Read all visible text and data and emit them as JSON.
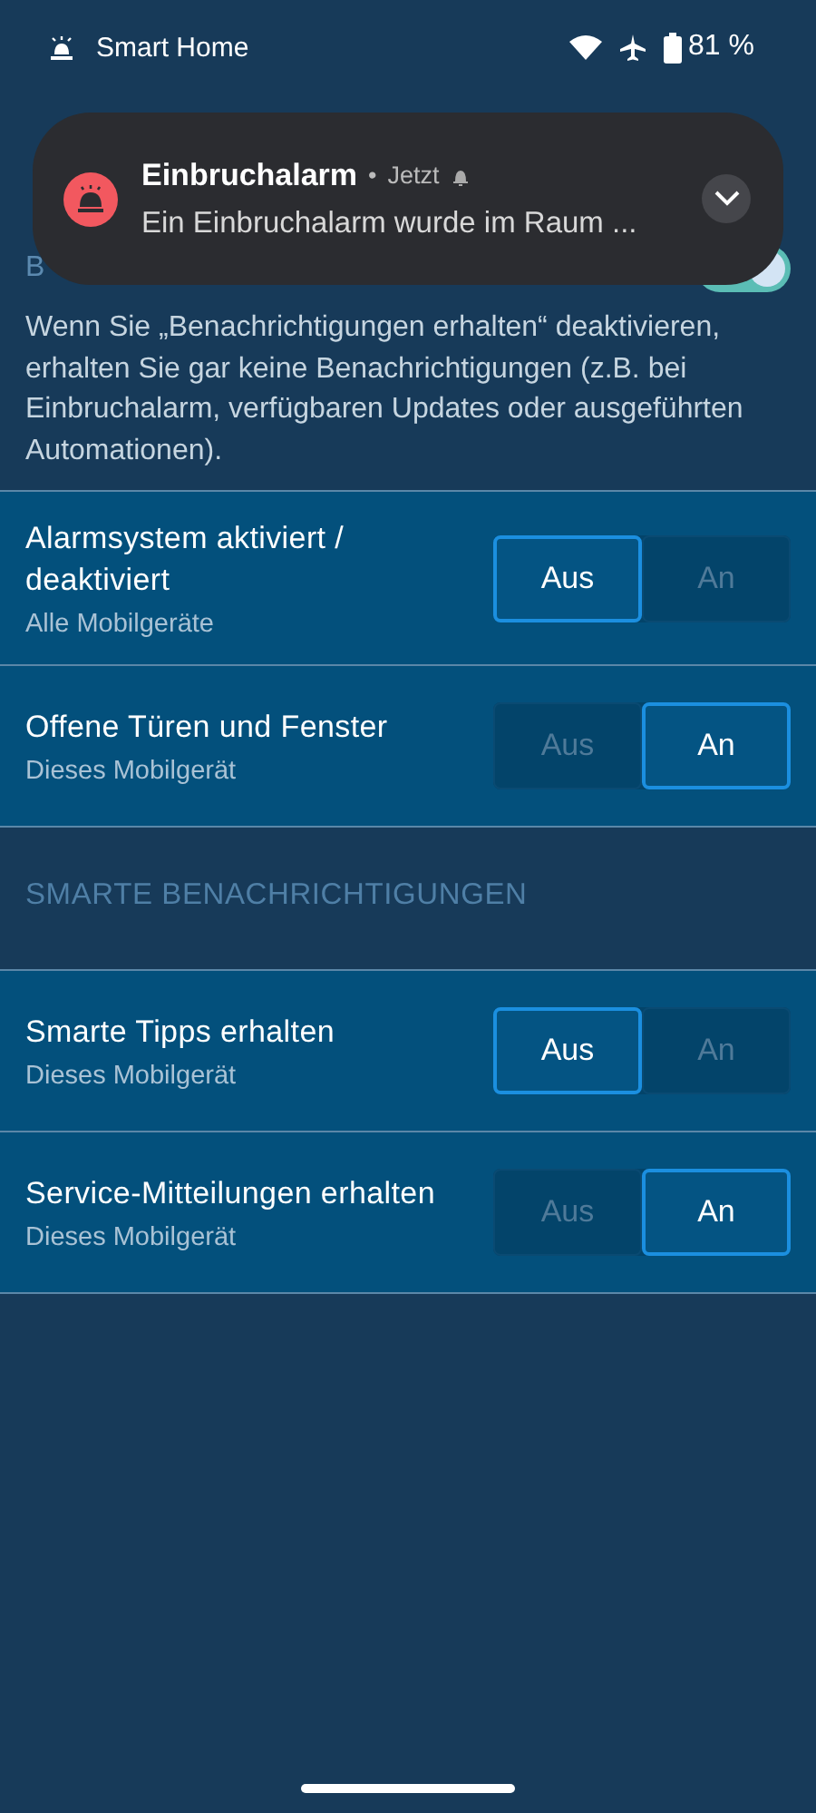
{
  "status_bar": {
    "app": "Smart Home",
    "battery": "81 %"
  },
  "notification": {
    "title": "Einbruchalarm",
    "separator": "•",
    "time": "Jetzt",
    "message": "Ein Einbruchalarm wurde im Raum ..."
  },
  "section_top": {
    "title": "B",
    "toggle": {
      "on": true
    },
    "description": "Wenn Sie „Benachrichtigungen erhalten“ deaktivieren, erhalten Sie gar keine Benachrichtigungen (z.B. bei Einbruchalarm, verfügbaren Updates oder ausgeführten Automationen)."
  },
  "groups": [
    {
      "rows": [
        {
          "title": "Alarmsystem aktiviert / deaktiviert",
          "subtitle": "Alle Mobilgeräte",
          "options": [
            {
              "label": "Aus",
              "selected": true
            },
            {
              "label": "An",
              "selected": false
            }
          ]
        },
        {
          "title": "Offene Türen und Fenster",
          "subtitle": "Dieses Mobilgerät",
          "options": [
            {
              "label": "Aus",
              "selected": false
            },
            {
              "label": "An",
              "selected": true
            }
          ]
        }
      ]
    },
    {
      "header": "SMARTE BENACHRICHTIGUNGEN",
      "rows": [
        {
          "title": "Smarte Tipps erhalten",
          "subtitle": "Dieses Mobilgerät",
          "options": [
            {
              "label": "Aus",
              "selected": true
            },
            {
              "label": "An",
              "selected": false
            }
          ]
        },
        {
          "title": "Service-Mitteilungen erhalten",
          "subtitle": "Dieses Mobilgerät",
          "options": [
            {
              "label": "Aus",
              "selected": false
            },
            {
              "label": "An",
              "selected": true
            }
          ]
        }
      ]
    }
  ]
}
